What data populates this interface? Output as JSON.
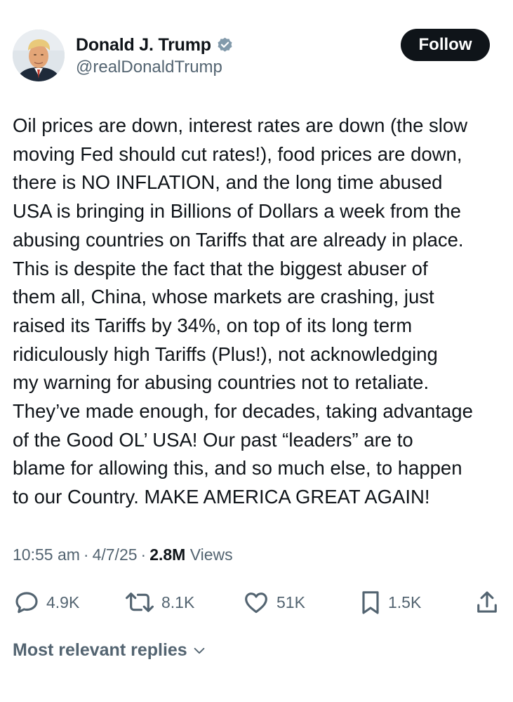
{
  "author": {
    "display_name": "Donald J. Trump",
    "handle": "@realDonaldTrump",
    "verified": true
  },
  "follow_button": {
    "label": "Follow"
  },
  "post": {
    "lines": [
      "Oil prices are down, interest rates are down (the slow",
      "moving Fed should cut rates!), food prices are down,",
      "there is NO INFLATION, and the long time abused",
      "USA is bringing in Billions of Dollars a week from the",
      "abusing countries on Tariffs that are already in place.",
      "This is despite the fact that the biggest abuser of",
      "them all, China, whose markets are crashing, just",
      "raised its Tariffs by 34%, on top of its long term",
      "ridiculously high Tariffs (Plus!), not acknowledging",
      "my warning for abusing countries not to retaliate.",
      "They’ve made enough, for decades, taking advantage",
      "of the Good OL’ USA! Our past “leaders” are to",
      "blame for allowing this, and so much else, to happen",
      "to our Country. MAKE AMERICA GREAT AGAIN!"
    ]
  },
  "meta": {
    "time": "10:55 am",
    "separator": "·",
    "date": "4/7/25",
    "views_count": "2.8M",
    "views_label": "Views"
  },
  "actions": {
    "replies": "4.9K",
    "reposts": "8.1K",
    "likes": "51K",
    "bookmarks": "1.5K"
  },
  "icons": {
    "reply": "speech-bubble-icon",
    "repost": "repost-arrows-icon",
    "like": "heart-icon",
    "bookmark": "bookmark-icon",
    "share": "share-upload-icon",
    "verified": "verified-badge-icon",
    "sort": "chevron-down-icon"
  },
  "colors": {
    "text_primary": "#0f1419",
    "text_secondary": "#536471",
    "button_bg": "#0f1419",
    "button_text": "#ffffff",
    "verified_badge": "#829aab"
  },
  "replies_sort": {
    "label": "Most relevant replies"
  }
}
